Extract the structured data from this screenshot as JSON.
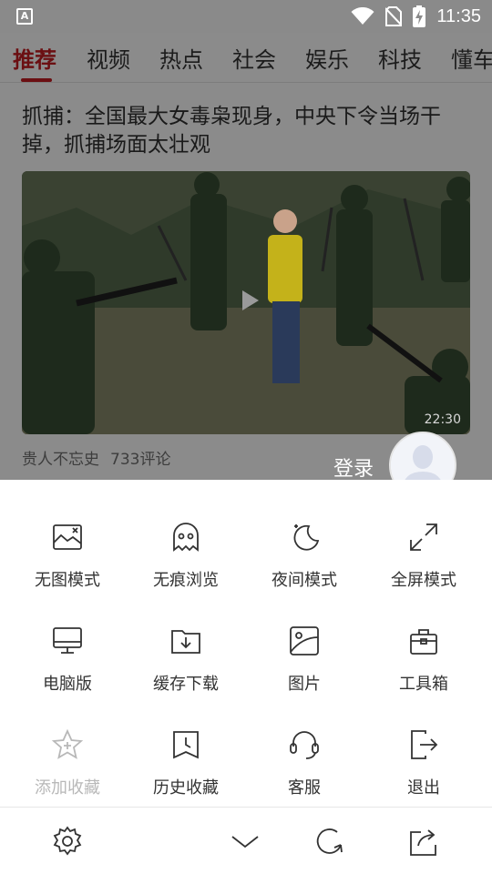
{
  "status_bar": {
    "time": "11:35",
    "app_badge": "A"
  },
  "tabs": [
    {
      "label": "推荐",
      "active": true
    },
    {
      "label": "视频",
      "active": false
    },
    {
      "label": "热点",
      "active": false
    },
    {
      "label": "社会",
      "active": false
    },
    {
      "label": "娱乐",
      "active": false
    },
    {
      "label": "科技",
      "active": false
    },
    {
      "label": "懂车",
      "active": false
    }
  ],
  "article": {
    "headline": "抓捕：全国最大女毒枭现身，中央下令当场干掉，抓捕场面太壮观",
    "duration": "22:30",
    "source": "贵人不忘史",
    "comments": "733评论"
  },
  "login": {
    "label": "登录"
  },
  "menu": {
    "rows": [
      [
        {
          "label": "无图模式",
          "icon": "no-image-icon",
          "enabled": true
        },
        {
          "label": "无痕浏览",
          "icon": "ghost-icon",
          "enabled": true
        },
        {
          "label": "夜间模式",
          "icon": "moon-icon",
          "enabled": true
        },
        {
          "label": "全屏模式",
          "icon": "fullscreen-icon",
          "enabled": true
        }
      ],
      [
        {
          "label": "电脑版",
          "icon": "desktop-icon",
          "enabled": true
        },
        {
          "label": "缓存下载",
          "icon": "download-folder-icon",
          "enabled": true
        },
        {
          "label": "图片",
          "icon": "picture-icon",
          "enabled": true
        },
        {
          "label": "工具箱",
          "icon": "toolbox-icon",
          "enabled": true
        }
      ],
      [
        {
          "label": "添加收藏",
          "icon": "star-add-icon",
          "enabled": false
        },
        {
          "label": "历史收藏",
          "icon": "history-icon",
          "enabled": true
        },
        {
          "label": "客服",
          "icon": "headset-icon",
          "enabled": true
        },
        {
          "label": "退出",
          "icon": "exit-icon",
          "enabled": true
        }
      ]
    ]
  },
  "bottom_bar": [
    "settings-icon",
    "chevron-down-icon",
    "refresh-icon",
    "share-icon"
  ],
  "colors": {
    "accent": "#6b0f12",
    "icon": "#333333",
    "disabled": "#b8b8b8",
    "overlay": "#8b8b8b"
  }
}
